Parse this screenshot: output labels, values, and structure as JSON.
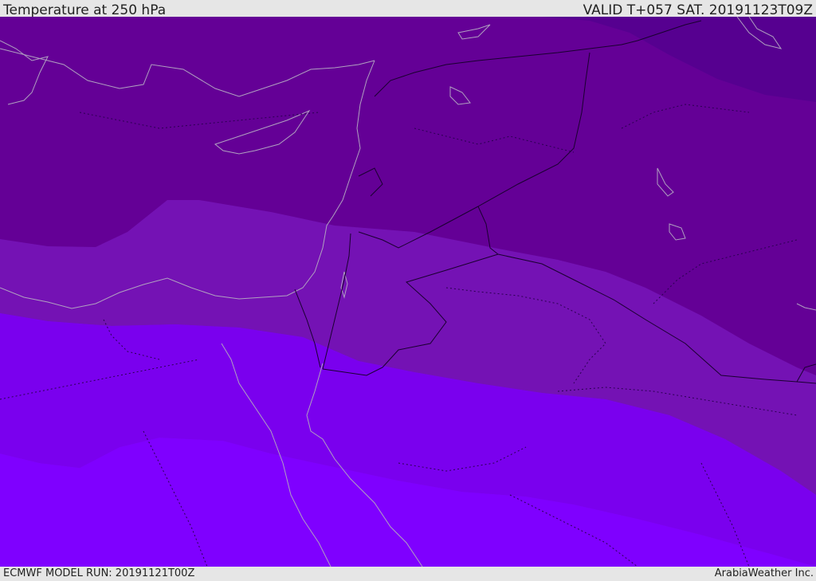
{
  "header": {
    "title": "Temperature at 250 hPa",
    "valid": "VALID T+057 SAT. 20191123T09Z"
  },
  "footer": {
    "model_run": "ECMWF MODEL RUN: 20191121T00Z",
    "credit": "ArabiaWeather Inc."
  },
  "colors": {
    "band_darkest": "#560090",
    "band_1": "#640096",
    "band_2": "#7412b4",
    "band_3": "#7d0ad8",
    "band_4": "#7a00ee",
    "band_5": "#7f00ff",
    "coastline": "#b0a0c0",
    "border": "#1a0030"
  }
}
